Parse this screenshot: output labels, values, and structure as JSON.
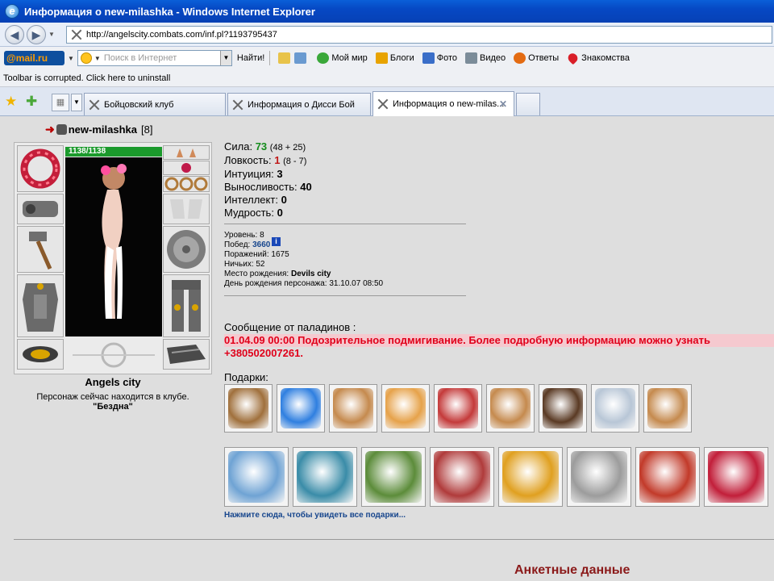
{
  "window": {
    "title": "Информация о new-milashka - Windows Internet Explorer"
  },
  "address": {
    "url": "http://angelscity.combats.com/inf.pl?1193795437"
  },
  "mailbar": {
    "logo_prefix": "@mail",
    "logo_suffix": ".ru",
    "search_placeholder": "Поиск в Интернет",
    "find_label": "Найти!",
    "items": [
      {
        "label": "Мой мир",
        "color": "#3aa83a"
      },
      {
        "label": "Блоги",
        "color": "#e8a300"
      },
      {
        "label": "Фото",
        "color": "#3a6ec8"
      },
      {
        "label": "Видео",
        "color": "#7b8c99"
      },
      {
        "label": "Ответы",
        "color": "#e36b12"
      },
      {
        "label": "Знакомства",
        "color": "#d91e28"
      }
    ]
  },
  "notice": "Toolbar is corrupted. Click here to uninstall",
  "tabs": [
    {
      "label": "Бойцовский клуб"
    },
    {
      "label": "Информация о Дисси Бой"
    },
    {
      "label": "Информация о new-milas..."
    }
  ],
  "character": {
    "name": "new-milashka",
    "level": "[8]",
    "info_mark": "i",
    "hp": "1138/1138"
  },
  "stats": {
    "strength_label": "Сила:",
    "strength": "73",
    "strength_detail": "(48 + 25)",
    "agility_label": "Ловкость:",
    "agility": "1",
    "agility_detail": "(8 - 7)",
    "intuition_label": "Интуиция:",
    "intuition": "3",
    "endurance_label": "Выносливость:",
    "endurance": "40",
    "intellect_label": "Интеллект:",
    "intellect": "0",
    "wisdom_label": "Мудрость:",
    "wisdom": "0"
  },
  "info": {
    "level_label": "Уровень:",
    "level": "8",
    "wins_label": "Побед:",
    "wins": "3660",
    "losses_label": "Поражений:",
    "losses": "1675",
    "draws_label": "Ничьих:",
    "draws": "52",
    "birthplace_label": "Место рождения:",
    "birthplace": "Devils city",
    "birthday_label": "День рождения персонажа:",
    "birthday": "31.10.07 08:50"
  },
  "location": {
    "city": "Angels city",
    "text": "Персонаж сейчас находится в клубе.",
    "room": "\"Бездна\""
  },
  "paladins": {
    "heading": "Сообщение от паладинов :",
    "line1": "01.04.09 00:00 Подозрительное подмигивание. Более подробную информацию можно узнать",
    "line2": "+380502007261."
  },
  "gifts": {
    "heading": "Подарки:",
    "show_all": "Нажмите сюда, чтобы увидеть все подарки...",
    "row1_colors": [
      "#a0703c",
      "#2f7fe0",
      "#c58a4e",
      "#e6a24a",
      "#c43a3a",
      "#c58a4e",
      "#5a3a24",
      "#b8c6d6",
      "#c58a4e"
    ],
    "row2_colors": [
      "#6fa3d4",
      "#3a8ca8",
      "#5c8c3a",
      "#b03b3b",
      "#e0a020",
      "#9c9c9c",
      "#c23a2a",
      "#c21f3a"
    ]
  },
  "anketa_heading": "Анкетные данные"
}
